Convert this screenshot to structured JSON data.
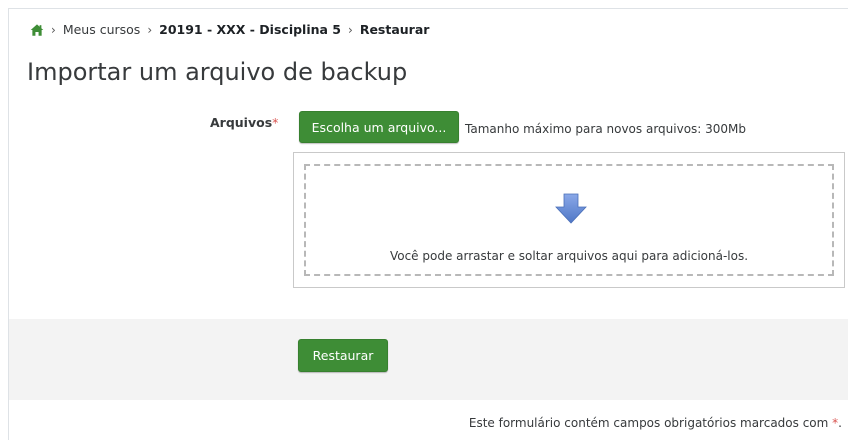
{
  "breadcrumb": {
    "home_icon": "home-icon",
    "items": [
      "Meus cursos",
      "20191 - XXX - Disciplina 5",
      "Restaurar"
    ],
    "separator": "›"
  },
  "page": {
    "title": "Importar um arquivo de backup"
  },
  "form": {
    "files_label": "Arquivos",
    "required_marker": "*",
    "choose_button": "Escolha um arquivo...",
    "max_size": "Tamanho máximo para novos arquivos: 300Mb",
    "drop_icon": "arrow-down-icon",
    "drop_text": "Você pode arrastar e soltar arquivos aqui para adicioná-los.",
    "submit_button": "Restaurar",
    "required_note": "Este formulário contém campos obrigatórios marcados com",
    "required_note_marker": "*",
    "required_note_end": "."
  },
  "colors": {
    "accent_green": "#3e8d36",
    "required_red": "#d9534f",
    "arrow_blue": "#6b8fd6",
    "footer_bg": "#f3f3f3"
  }
}
